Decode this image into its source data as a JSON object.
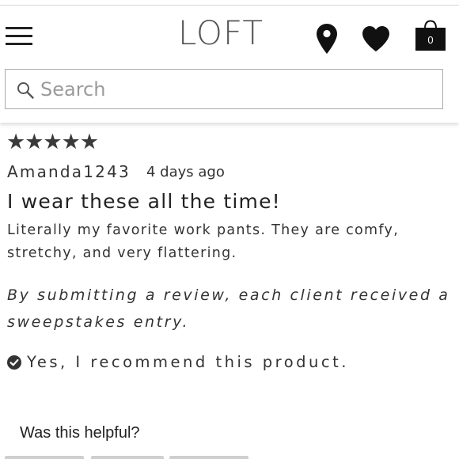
{
  "header": {
    "brand": "LOFT",
    "bag_count": "0",
    "icons": {
      "menu": "hamburger-menu-icon",
      "store_locator": "map-pin-icon",
      "wishlist": "heart-icon",
      "bag": "shopping-bag-icon",
      "search": "search-icon"
    }
  },
  "search": {
    "placeholder": "Search"
  },
  "review": {
    "rating": 5,
    "stars": "★★★★★",
    "author": "Amanda1243",
    "date": "4 days ago",
    "title": "I wear these all the time!",
    "body": "Literally my favorite work pants. They are comfy, stretchy, and very flattering.",
    "disclaimer": "By submitting a review, each client received a sweepstakes entry.",
    "recommend": "Yes, I recommend this product."
  },
  "helpful": {
    "label": "Was this helpful?"
  },
  "colors": {
    "text": "#333333",
    "logo": "#555555",
    "border": "#aaaaaa"
  }
}
